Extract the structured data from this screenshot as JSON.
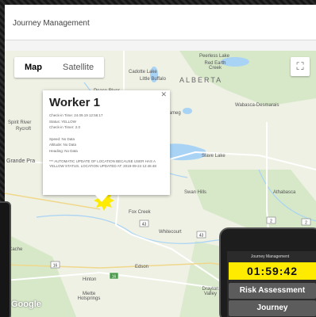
{
  "header": {
    "title": "Journey Management"
  },
  "map": {
    "map_type_buttons": [
      "Map",
      "Satellite"
    ],
    "selected_map_type": "Map",
    "fullscreen_icon": "fullscreen-icon",
    "province_label": "ALBERTA",
    "places": [
      "Peerless Lake",
      "Red Earth Creek",
      "Cadotte Lake",
      "Little Buffalo",
      "Peace River",
      "Wabasca-Desmarais",
      "Spirit River",
      "Rycroft",
      "Grande Pra",
      "Slave Lake",
      "Swan Hills",
      "Athabasca",
      "Fox Creek",
      "Whitecourt",
      "Edson",
      "Hinton",
      "Drayton Valley",
      "Miette Hotsprings",
      "e Cache",
      "Ikameg"
    ],
    "highways": [
      "43",
      "43",
      "16",
      "2",
      "2",
      "16"
    ],
    "attribution": "Google",
    "marker_color": "#ffeb00"
  },
  "infowindow": {
    "title": "Worker 1",
    "checkin_time": "Check-in Time: 24.09.19 12:56:17",
    "status": "Status: YELLOW",
    "checkin_timer": "Check-in Timer: 2.0",
    "speed": "Speed: No Data",
    "altitude": "Altitude: No Data",
    "heading": "Heading: No Data",
    "auto_update": "*** AUTOMATIC UPDATE OF LOCATION BECAUSE USER HAS A YELLOW STATUS. LOCATION UPDATED AT: 2019-09-24 12:46:48",
    "close_icon": "close-icon"
  },
  "phone": {
    "title": "Journey Management",
    "timer": "01:59:42",
    "buttons": [
      "Risk Assessment",
      "Journey"
    ]
  }
}
